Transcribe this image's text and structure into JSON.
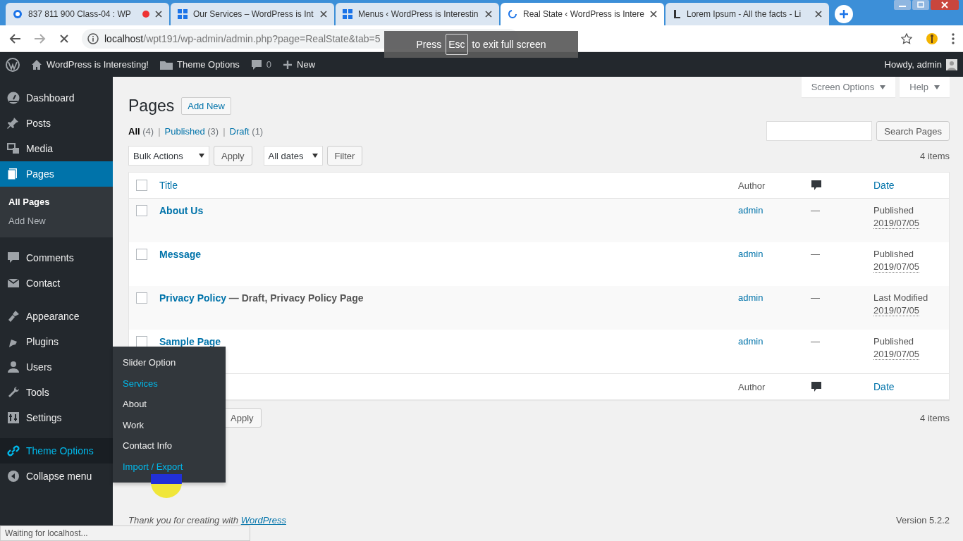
{
  "browser": {
    "tabs": [
      {
        "title": "837 811 900 Class-04 : WP",
        "selected": false,
        "recording": true
      },
      {
        "title": "Our Services – WordPress is Int",
        "selected": false,
        "recording": false
      },
      {
        "title": "Menus ‹ WordPress is Interestin",
        "selected": false,
        "recording": false
      },
      {
        "title": "Real State ‹ WordPress is Intere",
        "selected": true,
        "recording": false
      },
      {
        "title": "Lorem Ipsum - All the facts - Li",
        "selected": false,
        "recording": false
      }
    ],
    "address_host": "localhost",
    "address_path": "/wpt191/wp-admin/admin.php?page=RealState&tab=5",
    "fullscreen_notice": {
      "before": "Press",
      "key": "Esc",
      "after": "to exit full screen"
    },
    "status_text": "Waiting for localhost..."
  },
  "admin_bar": {
    "site": "WordPress is Interesting!",
    "theme_options": "Theme Options",
    "comments": "0",
    "new": "New",
    "greeting": "Howdy, admin"
  },
  "sidebar": {
    "items": [
      {
        "label": "Dashboard",
        "selected": false,
        "hovered": false
      },
      {
        "label": "Posts",
        "selected": false,
        "hovered": false
      },
      {
        "label": "Media",
        "selected": false,
        "hovered": false
      },
      {
        "label": "Pages",
        "selected": true,
        "hovered": false,
        "children": [
          {
            "label": "All Pages",
            "selected": true
          },
          {
            "label": "Add New",
            "selected": false
          }
        ]
      },
      {
        "label": "Comments",
        "selected": false,
        "hovered": false
      },
      {
        "label": "Contact",
        "selected": false,
        "hovered": false
      },
      {
        "label": "Appearance",
        "selected": false,
        "hovered": false
      },
      {
        "label": "Plugins",
        "selected": false,
        "hovered": false
      },
      {
        "label": "Users",
        "selected": false,
        "hovered": false
      },
      {
        "label": "Tools",
        "selected": false,
        "hovered": false
      },
      {
        "label": "Settings",
        "selected": false,
        "hovered": false
      },
      {
        "label": "Theme Options",
        "selected": false,
        "hovered": true
      },
      {
        "label": "Collapse menu",
        "selected": false,
        "hovered": false
      }
    ],
    "flyout": [
      {
        "label": "Slider Option",
        "highlighted": false
      },
      {
        "label": "Services",
        "highlighted": true
      },
      {
        "label": "About",
        "highlighted": false
      },
      {
        "label": "Work",
        "highlighted": false
      },
      {
        "label": "Contact Info",
        "highlighted": false
      },
      {
        "label": "Import / Export",
        "highlighted": true
      }
    ]
  },
  "page": {
    "title": "Pages",
    "add_new": "Add New",
    "screen_options": "Screen Options",
    "help": "Help",
    "filter_separator": "|",
    "filters": [
      {
        "label": "All",
        "count": "(4)",
        "selected": true
      },
      {
        "label": "Published",
        "count": "(3)",
        "selected": false
      },
      {
        "label": "Draft",
        "count": "(1)",
        "selected": false
      }
    ],
    "search_button": "Search Pages",
    "bulk_actions": "Bulk Actions",
    "apply": "Apply",
    "all_dates": "All dates",
    "filter": "Filter",
    "items_count": "4 items",
    "table": {
      "select_all_checked": false,
      "columns": [
        "Title",
        "Author",
        "Date"
      ],
      "rows": [
        {
          "checked": false,
          "title": "About Us",
          "author": "admin",
          "comments": "—",
          "status": "Published",
          "date": "2019/07/05"
        },
        {
          "checked": false,
          "title": "Message",
          "author": "admin",
          "comments": "—",
          "status": "Published",
          "date": "2019/07/05"
        },
        {
          "checked": false,
          "title": "Privacy Policy",
          "state": "— Draft, Privacy Policy Page",
          "author": "admin",
          "comments": "—",
          "status": "Last Modified",
          "date": "2019/07/05"
        },
        {
          "checked": false,
          "title": "Sample Page",
          "author": "admin",
          "comments": "—",
          "status": "Published",
          "date": "2019/07/05"
        }
      ],
      "footer_columns": [
        "Author",
        "Date"
      ]
    },
    "bottom_apply": "Apply",
    "bottom_items_count": "4 items",
    "footer_text": "Thank you for creating with",
    "footer_link": "WordPress",
    "version": "Version 5.2.2"
  }
}
